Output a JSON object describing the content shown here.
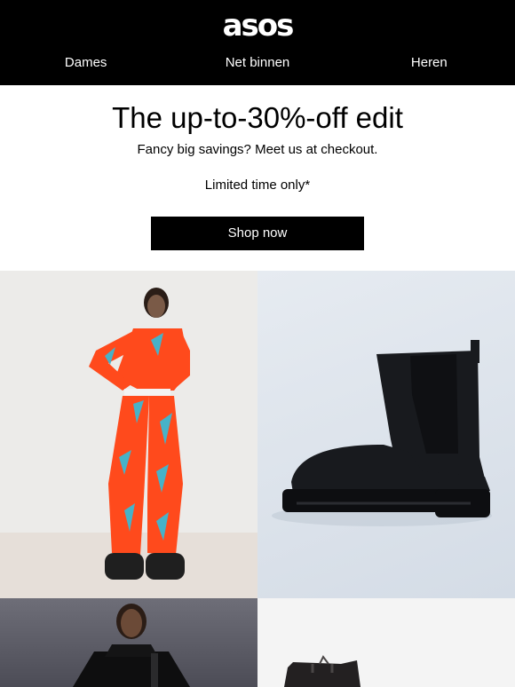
{
  "header": {
    "logo": "asos",
    "nav": [
      "Dames",
      "Net binnen",
      "Heren"
    ]
  },
  "hero": {
    "title": "The up-to-30%-off edit",
    "subtitle": "Fancy big savings? Meet us at checkout.",
    "note": "Limited time only*",
    "cta_label": "Shop now"
  },
  "products": [
    {
      "image": "orange-patterned-ski-suit"
    },
    {
      "image": "black-chelsea-boot"
    },
    {
      "image": "black-hoodie-model"
    },
    {
      "image": "black-leather-boot"
    }
  ],
  "colors": {
    "header_bg": "#000000",
    "page_bg": "#ffffff",
    "accent": "#ff4a1c"
  }
}
